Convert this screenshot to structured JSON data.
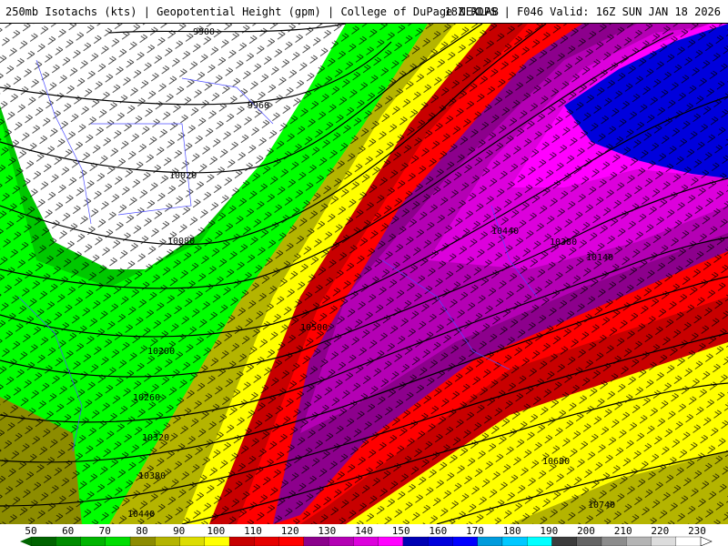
{
  "header": {
    "left": "250mb Isotachs (kts) | Geopotential Height (gpm) | College of DuPage NEXLAB",
    "right": "18Z RDPS | F046 Valid: 16Z SUN JAN 18 2026"
  },
  "height_labels": [
    "9900",
    "9960",
    "10020",
    "10080",
    "10140",
    "10200",
    "10260",
    "10320",
    "10380",
    "10440",
    "10500",
    "10380",
    "10440",
    "10680",
    "10740"
  ],
  "colorbar": {
    "labels": [
      "50",
      "60",
      "70",
      "80",
      "90",
      "100",
      "110",
      "120",
      "130",
      "140",
      "150",
      "160",
      "170",
      "180",
      "190",
      "200",
      "210",
      "220",
      "230"
    ],
    "colors": [
      "#006400",
      "#008c00",
      "#00b400",
      "#00dc00",
      "#8c8c00",
      "#b4b400",
      "#dcdc00",
      "#ffff00",
      "#c80000",
      "#e60000",
      "#ff0000",
      "#8c008c",
      "#b400b4",
      "#dc00dc",
      "#ff00ff",
      "#0000b4",
      "#0000dc",
      "#0000ff",
      "#009bdc",
      "#00c8ff",
      "#00ffff",
      "#3c3c3c",
      "#646464",
      "#8c8c8c",
      "#b4b4b4",
      "#dcdcdc",
      "#ffffff"
    ]
  }
}
